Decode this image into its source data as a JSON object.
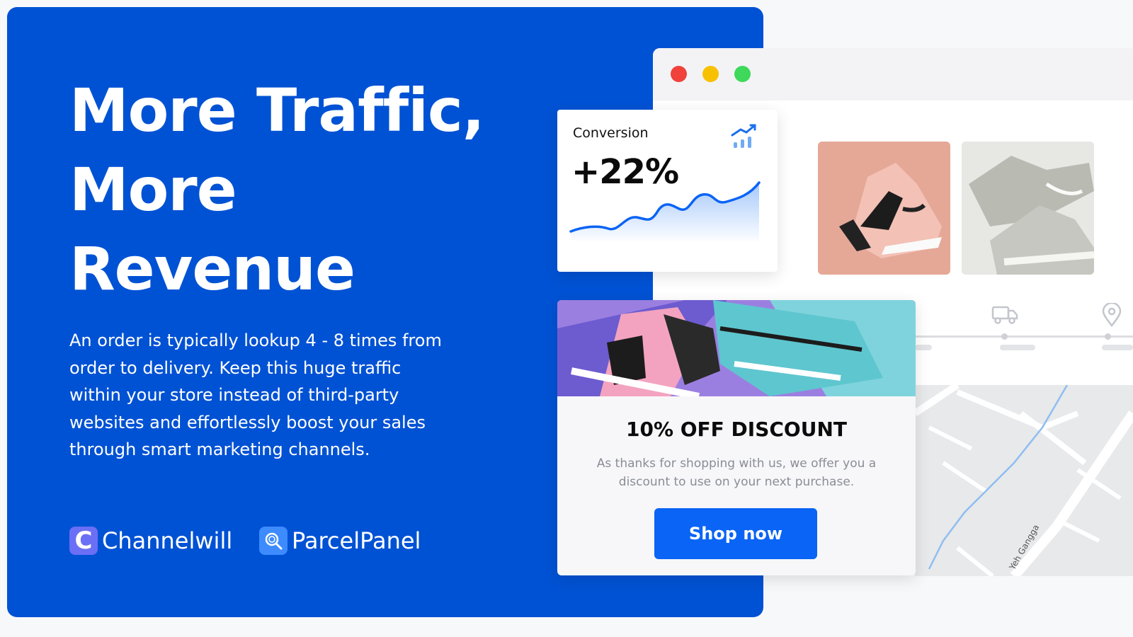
{
  "hero": {
    "headline_line1": "More Traffic,",
    "headline_line2": "More",
    "headline_line3": "Revenue",
    "description": "An order is typically lookup 4 - 8 times from order to delivery. Keep this huge traffic within your store instead of third-party websites and effortlessly boost your sales through smart marketing channels."
  },
  "brands": {
    "channelwill": "Channelwill",
    "parcelpanel": "ParcelPanel",
    "channelwill_logo_letter": "C"
  },
  "browser": {
    "window_controls": [
      "close",
      "minimize",
      "maximize"
    ]
  },
  "conversion_card": {
    "label": "Conversion",
    "value": "+22%",
    "icon": "chart-trend-up-icon"
  },
  "tracking": {
    "icons": [
      "truck-icon",
      "location-pin-icon"
    ]
  },
  "map": {
    "street_label": "Yeh Gangga"
  },
  "discount_card": {
    "title": "10% OFF DISCOUNT",
    "text": "As thanks for shopping with us, we offer you a discount to use on your next purchase.",
    "button_label": "Shop now"
  },
  "colors": {
    "panel_blue": "#0052d4",
    "button_blue": "#0a64f5",
    "channelwill_purple": "#6b6ff5",
    "parcelpanel_blue": "#3d8bff"
  }
}
